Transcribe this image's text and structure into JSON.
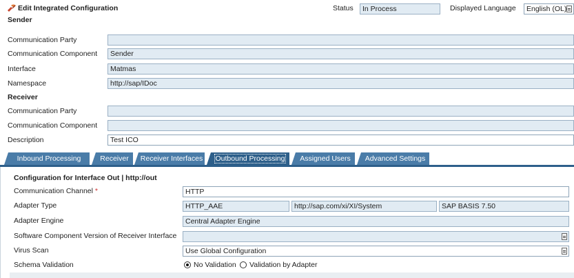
{
  "header": {
    "title": "Edit Integrated Configuration",
    "status_label": "Status",
    "status_value": "In Process",
    "language_label": "Displayed Language",
    "language_value": "English (OL)"
  },
  "sender": {
    "section_title": "Sender",
    "fields": [
      {
        "label": "Communication Party",
        "value": ""
      },
      {
        "label": "Communication Component",
        "value": "Sender"
      },
      {
        "label": "Interface",
        "value": "Matmas"
      },
      {
        "label": "Namespace",
        "value": "http://sap/IDoc"
      }
    ]
  },
  "receiver": {
    "section_title": "Receiver",
    "fields": [
      {
        "label": "Communication Party",
        "value": ""
      },
      {
        "label": "Communication Component",
        "value": ""
      }
    ]
  },
  "description": {
    "label": "Description",
    "value": "Test ICO"
  },
  "tabs": [
    {
      "label": "Inbound Processing"
    },
    {
      "label": "Receiver"
    },
    {
      "label": "Receiver Interfaces"
    },
    {
      "label": "Outbound Processing",
      "active": true
    },
    {
      "label": "Assigned Users"
    },
    {
      "label": "Advanced Settings"
    }
  ],
  "outbound": {
    "config_title": "Configuration for Interface Out | http://out",
    "channel_label": "Communication Channel",
    "required_mark": "*",
    "channel_value": "HTTP",
    "adapter_type_label": "Adapter Type",
    "adapter_type_value": "HTTP_AAE",
    "adapter_namespace": "http://sap.com/xi/XI/System",
    "adapter_swc": "SAP BASIS 7.50",
    "adapter_engine_label": "Adapter Engine",
    "adapter_engine_value": "Central Adapter Engine",
    "swcv_label": "Software Component Version of Receiver Interface",
    "swcv_value": "",
    "virus_scan_label": "Virus Scan",
    "virus_scan_value": "Use Global Configuration",
    "schema_validation_label": "Schema Validation",
    "schema_options": [
      {
        "label": "No Validation",
        "selected": true
      },
      {
        "label": "Validation by Adapter",
        "selected": false
      }
    ]
  },
  "colors": {
    "tab_bg": "#4a7ca8",
    "tab_active_bg": "#2d5f8a",
    "readonly_field_bg": "#e1ebf3",
    "required_mark": "#d03030",
    "icon_accent": "#c8452e"
  }
}
